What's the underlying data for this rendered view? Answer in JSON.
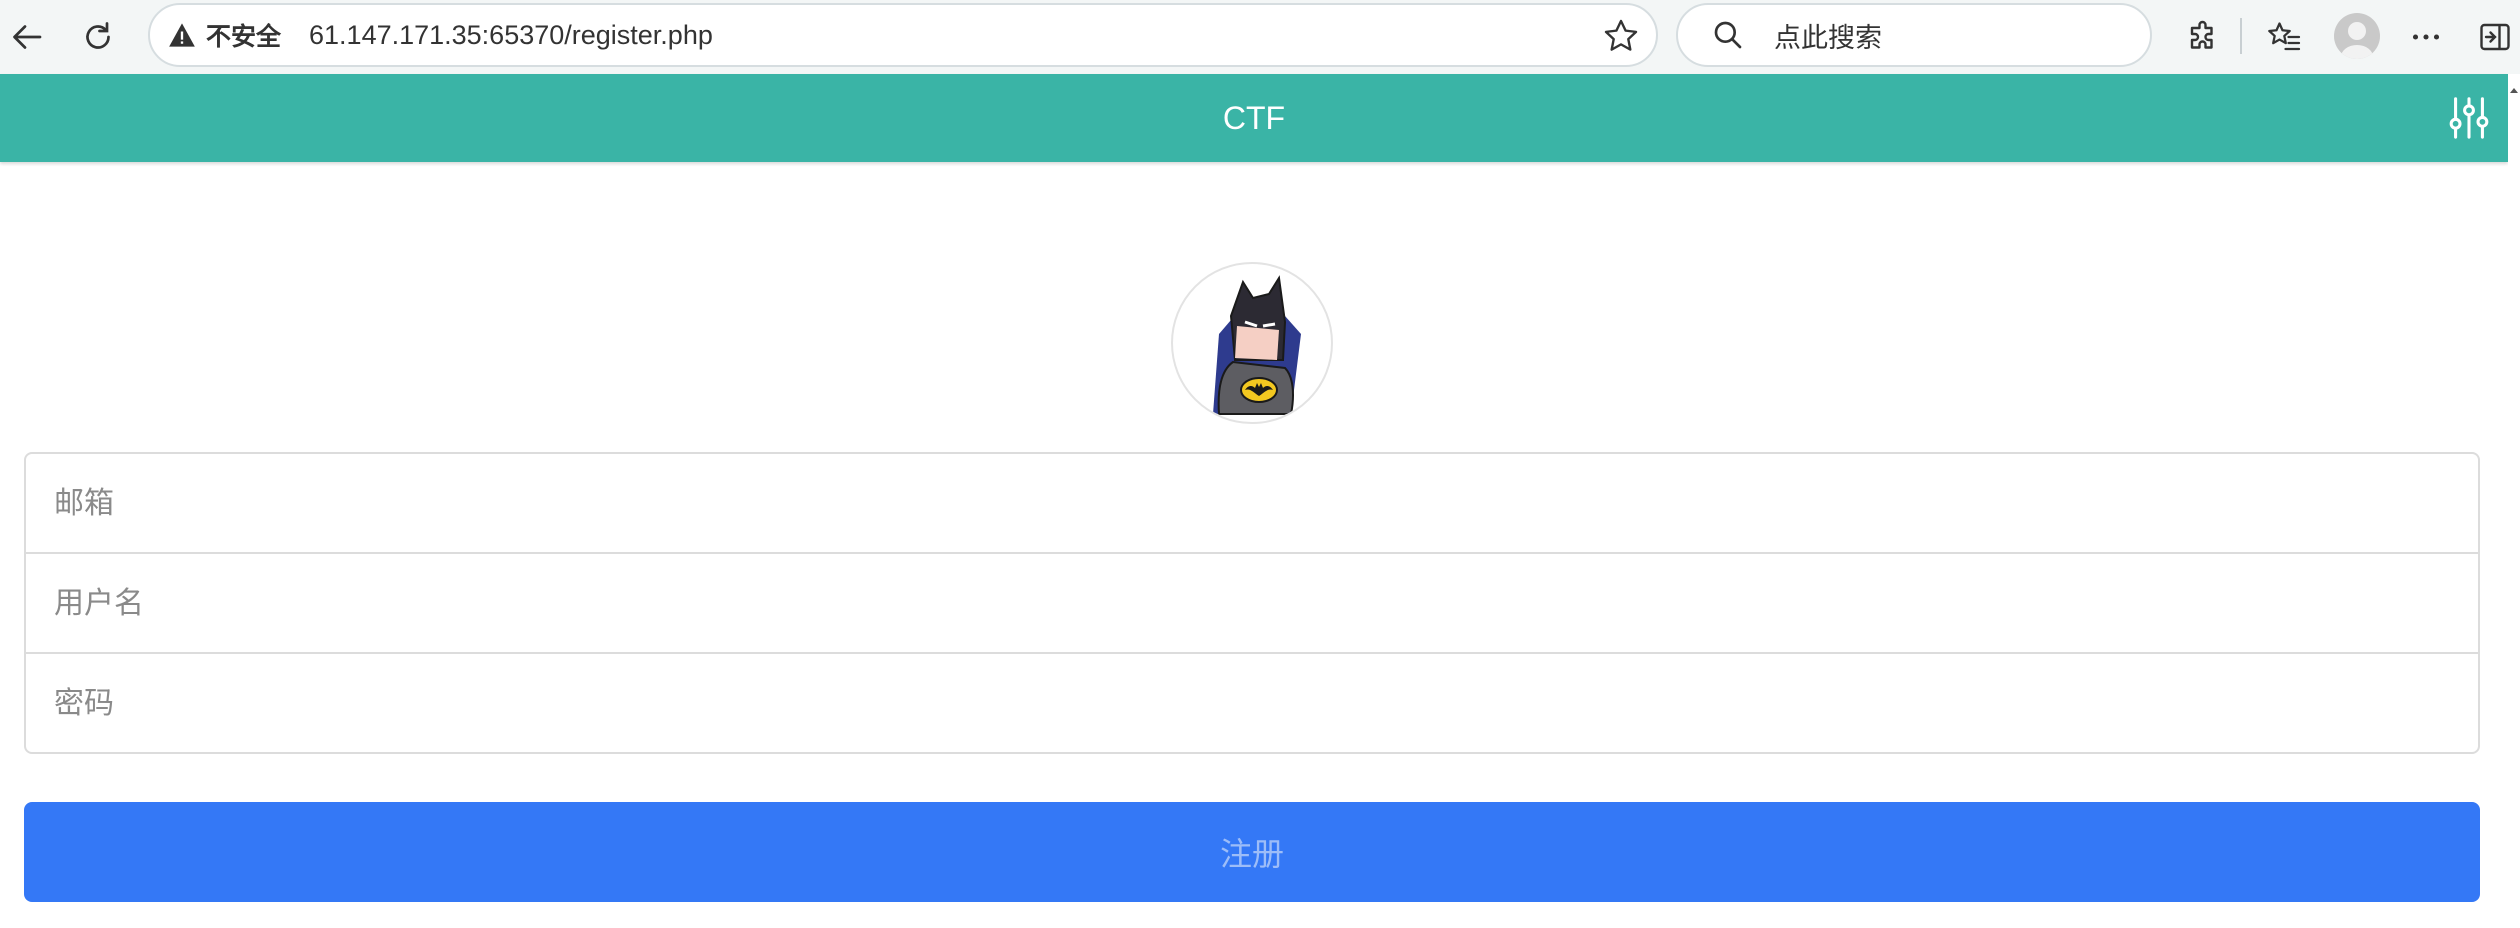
{
  "browser": {
    "security_label": "不安全",
    "url": "61.147.171.35:65370/register.php",
    "search_placeholder": "点此搜索",
    "icons": [
      "back-arrow-icon",
      "refresh-icon",
      "warning-icon",
      "star-icon",
      "search-icon",
      "extensions-icon",
      "favorites-icon",
      "profile-icon",
      "more-icon",
      "sidebar-icon"
    ]
  },
  "app": {
    "title": "CTF",
    "header_color": "#3ab4a6",
    "settings_icon": "sliders-icon"
  },
  "form": {
    "email_placeholder": "邮箱",
    "username_placeholder": "用户名",
    "password_placeholder": "密码",
    "submit_label": "注册",
    "submit_color": "#3478f6"
  }
}
